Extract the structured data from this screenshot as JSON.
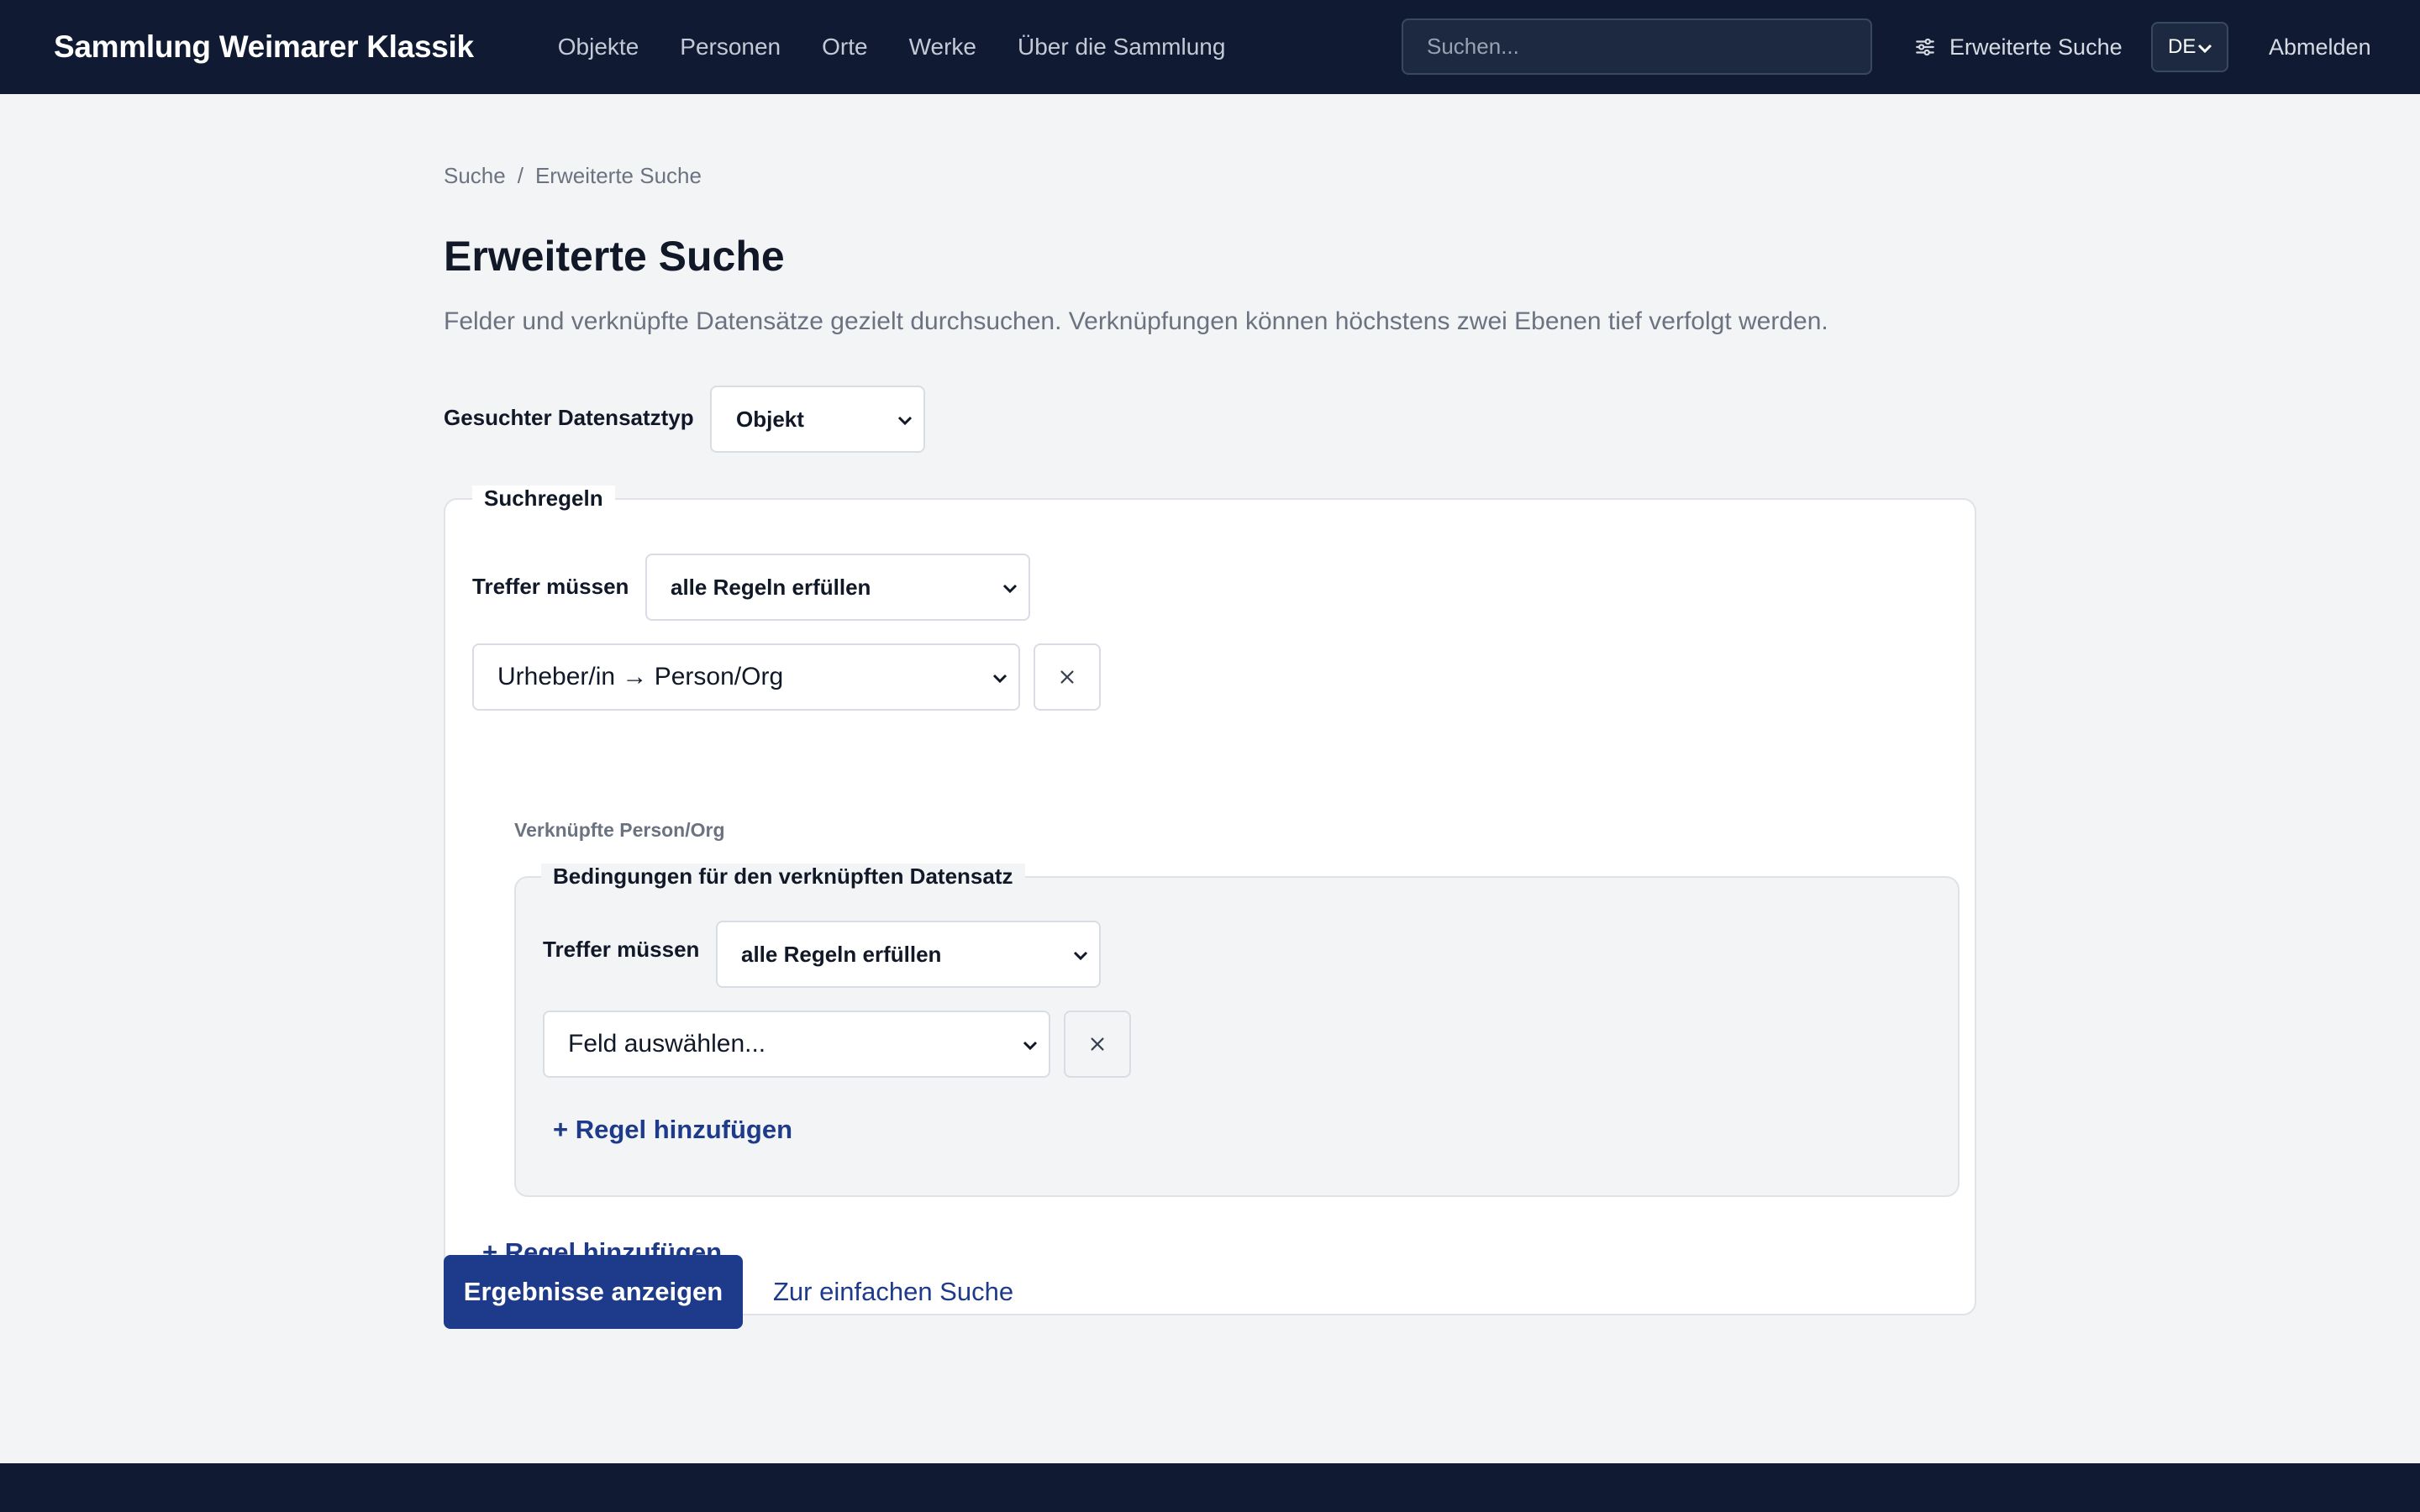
{
  "header": {
    "brand": "Sammlung Weimarer Klassik",
    "nav": [
      "Objekte",
      "Personen",
      "Orte",
      "Werke",
      "Über die Sammlung"
    ],
    "search_placeholder": "Suchen...",
    "advanced_search": "Erweiterte Suche",
    "language": "DE",
    "logout": "Abmelden"
  },
  "breadcrumb": {
    "items": [
      "Suche",
      "Erweiterte Suche"
    ],
    "separator": "/"
  },
  "page": {
    "title": "Erweiterte Suche",
    "description": "Felder und verknüpfte Datensätze gezielt durchsuchen. Verknüpfungen können höchstens zwei Ebenen tief verfolgt werden."
  },
  "record_type": {
    "label": "Gesuchter Datensatztyp",
    "value": "Objekt"
  },
  "rules": {
    "legend": "Suchregeln",
    "match_label": "Treffer müssen",
    "match_value": "alle Regeln erfüllen",
    "rule_field": "Urheber/in → Person/Org",
    "linked_label": "Verknüpfte Person/Org",
    "nested": {
      "legend": "Bedingungen für den verknüpften Datensatz",
      "match_label": "Treffer müssen",
      "match_value": "alle Regeln erfüllen",
      "field_placeholder": "Feld auswählen...",
      "add_rule": "+ Regel hinzufügen"
    },
    "add_rule": "+ Regel hinzufügen"
  },
  "actions": {
    "submit": "Ergebnisse anzeigen",
    "simple_search": "Zur einfachen Suche"
  },
  "colors": {
    "header_bg": "#101b33",
    "page_bg": "#f3f4f6",
    "primary": "#1e3a8a"
  }
}
